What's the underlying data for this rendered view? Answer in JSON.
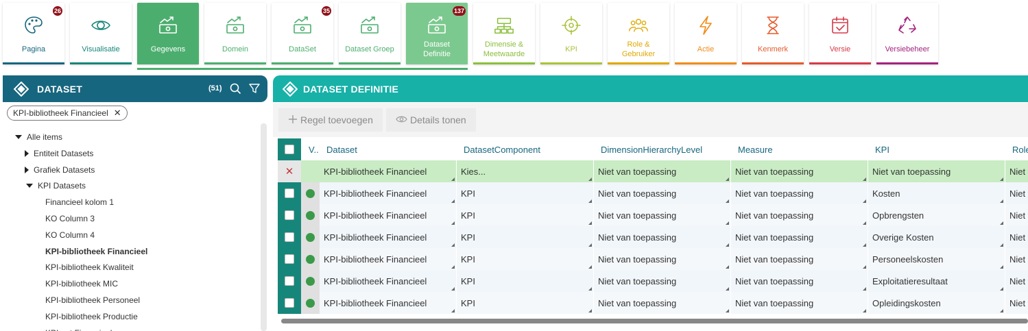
{
  "tiles": [
    {
      "label": "Pagina",
      "badge": "26",
      "icon": "palette-icon",
      "color": "#17667f",
      "bar": "#17667f"
    },
    {
      "label": "Visualisatie",
      "badge": "",
      "icon": "eye-icon",
      "color": "#17867a",
      "bar": "#17867a"
    },
    {
      "label": "Gegevens",
      "badge": "",
      "icon": "money-trend-icon",
      "color": "#ffffff",
      "bar": "#4cae6e",
      "active": true
    },
    {
      "label": "Domein",
      "badge": "",
      "icon": "money-trend-icon",
      "color": "#4cae6e",
      "bar": "#4cae6e"
    },
    {
      "label": "DataSet",
      "badge": "35",
      "icon": "money-trend-icon",
      "color": "#4cae6e",
      "bar": "#4cae6e"
    },
    {
      "label": "Dataset Groep",
      "badge": "",
      "icon": "money-trend-icon",
      "color": "#4cae6e",
      "bar": "#4cae6e"
    },
    {
      "label": "Dataset Definitie",
      "badge": "137",
      "icon": "money-trend-icon",
      "color": "#ffffff",
      "bar": "#7cc98f",
      "selected": true
    },
    {
      "label": "Dimensie & Meetwaarde",
      "badge": "",
      "icon": "dimension-icon",
      "color": "#8bbf3c",
      "bar": "#8bbf3c"
    },
    {
      "label": "KPI",
      "badge": "",
      "icon": "target-icon",
      "color": "#a9c33a",
      "bar": "#a9c33a"
    },
    {
      "label": "Role & Gebruiker",
      "badge": "",
      "icon": "users-icon",
      "color": "#e0a800",
      "bar": "#e0a800"
    },
    {
      "label": "Actie",
      "badge": "",
      "icon": "lightning-icon",
      "color": "#f08c1a",
      "bar": "#f08c1a"
    },
    {
      "label": "Kenmerk",
      "badge": "",
      "icon": "hourglass-icon",
      "color": "#e55a2b",
      "bar": "#e55a2b"
    },
    {
      "label": "Versie",
      "badge": "",
      "icon": "calendar-check-icon",
      "color": "#d63a48",
      "bar": "#d63a48"
    },
    {
      "label": "Versiebeheer",
      "badge": "",
      "icon": "recycle-icon",
      "color": "#a3237e",
      "bar": "#a3237e"
    }
  ],
  "left": {
    "title": "DATASET",
    "count": "(51)",
    "filter_chip": "KPI-bibliotheek Financieel",
    "tree": [
      {
        "label": "Alle items",
        "level": 0,
        "toggle": "down"
      },
      {
        "label": "Entiteit Datasets",
        "level": 1,
        "toggle": "right"
      },
      {
        "label": "Grafiek Datasets",
        "level": 1,
        "toggle": "right"
      },
      {
        "label": "KPI Datasets",
        "level": 1,
        "toggle": "down"
      },
      {
        "label": "Financieel kolom 1",
        "level": 2
      },
      {
        "label": "KO Column 3",
        "level": 2
      },
      {
        "label": "KO Column 4",
        "level": 2
      },
      {
        "label": "KPI-bibliotheek Financieel",
        "level": 2,
        "selected": true
      },
      {
        "label": "KPI-bibliotheek Kwaliteit",
        "level": 2
      },
      {
        "label": "KPI-bibliotheek MIC",
        "level": 2
      },
      {
        "label": "KPI-bibliotheek Personeel",
        "level": 2
      },
      {
        "label": "KPI-bibliotheek Productie",
        "level": 2
      },
      {
        "label": "KPI-set Financieel",
        "level": 2
      }
    ]
  },
  "right": {
    "title": "DATASET DEFINITIE",
    "toolbar": {
      "add_label": "Regel toevoegen",
      "details_label": "Details tonen"
    },
    "columns": [
      "V..",
      "Dataset",
      "DatasetComponent",
      "DimensionHierarchyLevel",
      "Measure",
      "KPI",
      "Role"
    ],
    "rows": [
      {
        "status": "new",
        "cells": [
          "KPI-bibliotheek Financieel",
          "Kies...",
          "Niet van toepassing",
          "Niet van toepassing",
          "Niet van toepassing",
          "Niet v"
        ]
      },
      {
        "status": "ok",
        "cells": [
          "KPI-bibliotheek Financieel",
          "KPI",
          "Niet van toepassing",
          "Niet van toepassing",
          "Kosten",
          "Niet v"
        ]
      },
      {
        "status": "ok",
        "cells": [
          "KPI-bibliotheek Financieel",
          "KPI",
          "Niet van toepassing",
          "Niet van toepassing",
          "Opbrengsten",
          "Niet v"
        ]
      },
      {
        "status": "ok",
        "cells": [
          "KPI-bibliotheek Financieel",
          "KPI",
          "Niet van toepassing",
          "Niet van toepassing",
          "Overige Kosten",
          "Niet v"
        ]
      },
      {
        "status": "ok",
        "cells": [
          "KPI-bibliotheek Financieel",
          "KPI",
          "Niet van toepassing",
          "Niet van toepassing",
          "Personeelskosten",
          "Niet v"
        ]
      },
      {
        "status": "ok",
        "cells": [
          "KPI-bibliotheek Financieel",
          "KPI",
          "Niet van toepassing",
          "Niet van toepassing",
          "Exploitatieresultaat",
          "Niet v"
        ]
      },
      {
        "status": "ok",
        "cells": [
          "KPI-bibliotheek Financieel",
          "KPI",
          "Niet van toepassing",
          "Niet van toepassing",
          "Opleidingskosten",
          "Niet v"
        ]
      }
    ]
  }
}
